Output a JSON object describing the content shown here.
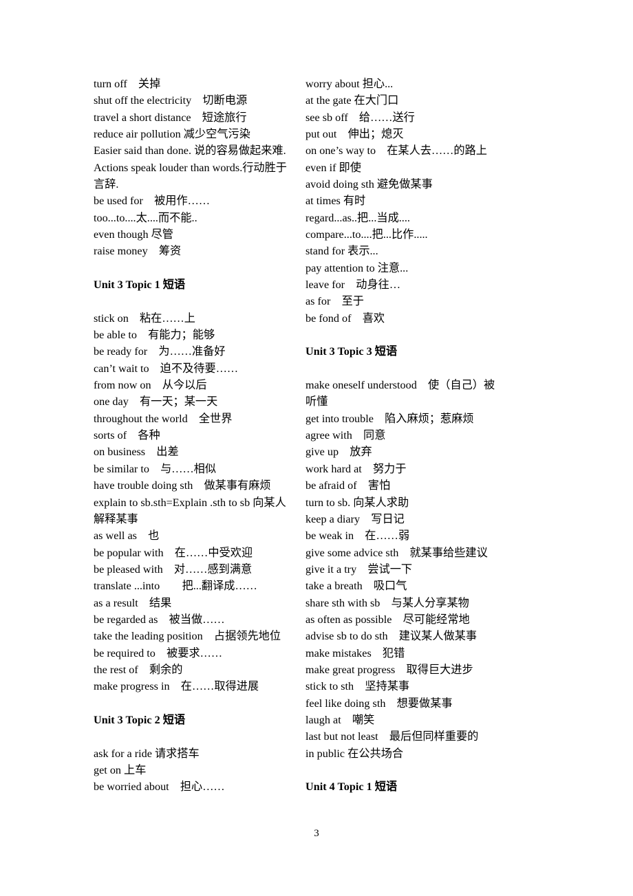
{
  "document": {
    "page_number": "3",
    "columns": [
      {
        "name": "left-column",
        "blocks": [
          {
            "type": "entry",
            "text": "turn off　关掉"
          },
          {
            "type": "entry",
            "text": "shut off the electricity　切断电源"
          },
          {
            "type": "entry",
            "text": "travel a short distance　短途旅行"
          },
          {
            "type": "entry",
            "text": "reduce air pollution 减少空气污染"
          },
          {
            "type": "entry",
            "text": "Easier said than done. 说的容易做起来难."
          },
          {
            "type": "entry",
            "text": "Actions speak louder than words.行动胜于言辞."
          },
          {
            "type": "entry",
            "text": "be used for　被用作……"
          },
          {
            "type": "entry",
            "text": "too...to....太....而不能.."
          },
          {
            "type": "entry",
            "text": "even though 尽管"
          },
          {
            "type": "entry",
            "text": "raise money　筹资"
          },
          {
            "type": "heading",
            "text": "Unit 3 Topic 1 短语"
          },
          {
            "type": "entry",
            "text": "stick on　粘在……上"
          },
          {
            "type": "entry",
            "text": "be able to　有能力；能够"
          },
          {
            "type": "entry",
            "text": "be ready for　为……准备好"
          },
          {
            "type": "entry",
            "text": "can’t wait to　迫不及待要……"
          },
          {
            "type": "entry",
            "text": "from now on　从今以后"
          },
          {
            "type": "entry",
            "text": "one day　有一天；某一天"
          },
          {
            "type": "entry",
            "text": "throughout the world　全世界"
          },
          {
            "type": "entry",
            "text": "sorts of　各种"
          },
          {
            "type": "entry",
            "text": "on business　出差"
          },
          {
            "type": "entry",
            "text": "be similar to　与……相似"
          },
          {
            "type": "entry",
            "text": "have trouble doing sth　做某事有麻烦"
          },
          {
            "type": "entry",
            "text": "explain to sb.sth=Explain .sth to sb 向某人解释某事"
          },
          {
            "type": "entry",
            "text": "as well as　也"
          },
          {
            "type": "entry",
            "text": "be popular with　在……中受欢迎"
          },
          {
            "type": "entry",
            "text": "be pleased with　对……感到满意"
          },
          {
            "type": "entry",
            "text": "translate ...into　　把...翻译成……"
          },
          {
            "type": "entry",
            "text": "as a result　结果"
          },
          {
            "type": "entry",
            "text": "be regarded as　被当做……"
          },
          {
            "type": "entry",
            "text": "take the leading position　占据领先地位"
          },
          {
            "type": "entry",
            "text": "be required to　被要求……"
          },
          {
            "type": "entry",
            "text": "the rest of　剩余的"
          },
          {
            "type": "entry",
            "text": "make progress in　在……取得进展"
          },
          {
            "type": "heading",
            "text": "Unit 3 Topic 2 短语"
          },
          {
            "type": "entry",
            "text": "ask for a ride 请求搭车"
          },
          {
            "type": "entry",
            "text": "get on 上车"
          },
          {
            "type": "entry",
            "text": "be worried about　担心……"
          }
        ]
      },
      {
        "name": "right-column",
        "blocks": [
          {
            "type": "entry",
            "text": "worry about 担心..."
          },
          {
            "type": "entry",
            "text": "at the gate 在大门口"
          },
          {
            "type": "entry",
            "text": "see sb off　给……送行"
          },
          {
            "type": "entry",
            "text": "put out　伸出；熄灭"
          },
          {
            "type": "entry",
            "text": "on one’s way to　在某人去……的路上"
          },
          {
            "type": "entry",
            "text": "even if 即使"
          },
          {
            "type": "entry",
            "text": "avoid doing sth 避免做某事"
          },
          {
            "type": "entry",
            "text": "at times 有时"
          },
          {
            "type": "entry",
            "text": "regard...as..把...当成...."
          },
          {
            "type": "entry",
            "text": "compare...to....把...比作....."
          },
          {
            "type": "entry",
            "text": "stand for 表示..."
          },
          {
            "type": "entry",
            "text": "pay attention to 注意..."
          },
          {
            "type": "entry",
            "text": "leave for　动身往…"
          },
          {
            "type": "entry",
            "text": "as for　至于"
          },
          {
            "type": "entry",
            "text": "be fond of　喜欢"
          },
          {
            "type": "heading",
            "text": "Unit 3 Topic 3 短语"
          },
          {
            "type": "entry",
            "text": "make oneself understood　使（自己）被听懂"
          },
          {
            "type": "entry",
            "text": "get into trouble　陷入麻烦；惹麻烦"
          },
          {
            "type": "entry",
            "text": "agree with　同意"
          },
          {
            "type": "entry",
            "text": "give up　放弃"
          },
          {
            "type": "entry",
            "text": "work hard at　努力于"
          },
          {
            "type": "entry",
            "text": "be afraid of　害怕"
          },
          {
            "type": "entry",
            "text": "turn to sb. 向某人求助"
          },
          {
            "type": "entry",
            "text": "keep a diary　写日记"
          },
          {
            "type": "entry",
            "text": "be weak in　在……弱"
          },
          {
            "type": "entry",
            "text": "give some advice sth　就某事给些建议"
          },
          {
            "type": "entry",
            "text": "give it a try　尝试一下"
          },
          {
            "type": "entry",
            "text": "take a breath　吸口气"
          },
          {
            "type": "entry",
            "text": "share sth with sb　与某人分享某物"
          },
          {
            "type": "entry",
            "text": "as often as possible　尽可能经常地"
          },
          {
            "type": "entry",
            "text": "advise sb to do sth　建议某人做某事"
          },
          {
            "type": "entry",
            "text": "make mistakes　犯错"
          },
          {
            "type": "entry",
            "text": "make great progress　取得巨大进步"
          },
          {
            "type": "entry",
            "text": "stick to sth　坚持某事"
          },
          {
            "type": "entry",
            "text": "feel like doing sth　想要做某事"
          },
          {
            "type": "entry",
            "text": "laugh at　嘲笑"
          },
          {
            "type": "entry",
            "text": "last but not least　最后但同样重要的"
          },
          {
            "type": "entry",
            "text": "in public 在公共场合"
          },
          {
            "type": "heading",
            "text": "Unit 4 Topic 1 短语"
          }
        ]
      }
    ]
  }
}
